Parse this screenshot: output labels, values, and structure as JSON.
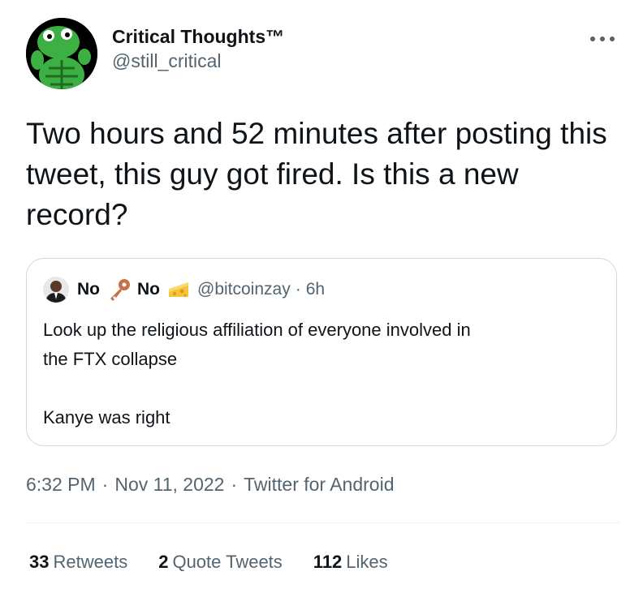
{
  "author": {
    "display_name": "Critical Thoughts™",
    "handle": "@still_critical",
    "avatar_icon": "green-turtle-avatar-icon"
  },
  "tweet": {
    "text": "Two hours and 52 minutes after posting this tweet, this guy got fired. Is this a new record?"
  },
  "quote": {
    "name_part1": "No",
    "emoji1_icon": "key-icon",
    "name_part2": "No",
    "emoji2_icon": "cheese-icon",
    "handle": "@bitcoinzay",
    "dot": "·",
    "time": "6h",
    "line1": "Look up the religious affiliation of everyone involved in",
    "line2": "the FTX collapse",
    "line3": "Kanye was right"
  },
  "meta": {
    "time": "6:32 PM",
    "sep": "·",
    "date": "Nov 11, 2022",
    "source": "Twitter for Android"
  },
  "stats": {
    "retweets_count": "33",
    "retweets_label": "Retweets",
    "quote_count": "2",
    "quote_label": "Quote Tweets",
    "likes_count": "112",
    "likes_label": "Likes"
  },
  "colors": {
    "text_primary": "#0f1419",
    "text_secondary": "#536471",
    "border": "#cfd9de",
    "avatar_green": "#3cb043"
  }
}
